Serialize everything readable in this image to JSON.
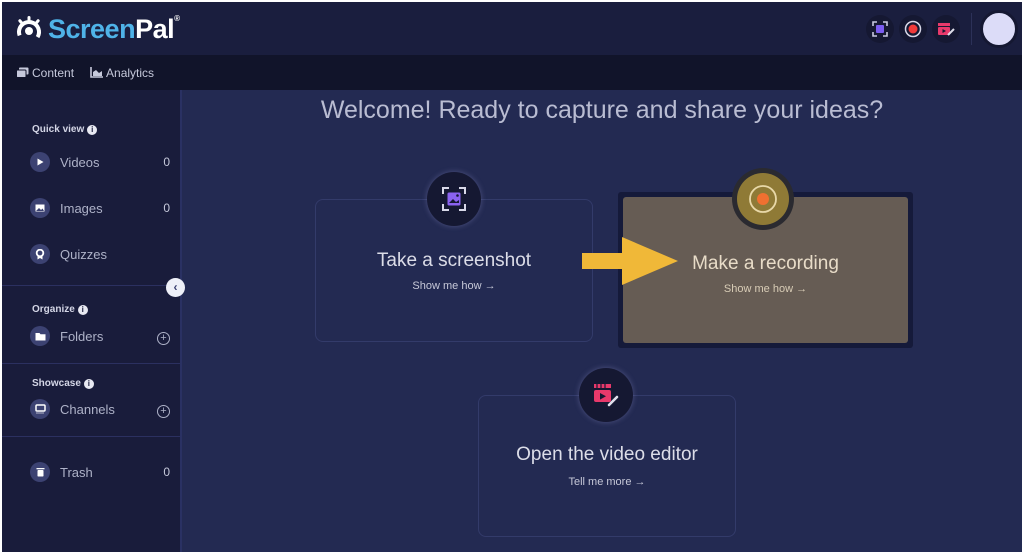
{
  "app": {
    "brand_prefix": "Screen",
    "brand_suffix": "Pal",
    "registered": "®"
  },
  "topbar": {
    "actions": [
      {
        "name": "screenshot",
        "icon": "screenshot-icon",
        "color": "#7b5cf0"
      },
      {
        "name": "record",
        "icon": "record-icon",
        "color": "#f03a3a"
      },
      {
        "name": "video-editor",
        "icon": "video-editor-icon",
        "color": "#e8396b"
      }
    ]
  },
  "subnav": {
    "items": [
      {
        "label": "Content",
        "icon": "content-icon"
      },
      {
        "label": "Analytics",
        "icon": "analytics-icon"
      }
    ]
  },
  "sidebar": {
    "quick_view": {
      "title": "Quick view",
      "info": "i",
      "items": [
        {
          "label": "Videos",
          "count": "0",
          "icon": "play-icon"
        },
        {
          "label": "Images",
          "count": "0",
          "icon": "image-icon"
        },
        {
          "label": "Quizzes",
          "count": "",
          "icon": "quiz-icon"
        }
      ]
    },
    "organize": {
      "title": "Organize",
      "info": "i",
      "items": [
        {
          "label": "Folders",
          "icon": "folder-icon",
          "action": "+"
        }
      ]
    },
    "showcase": {
      "title": "Showcase",
      "info": "i",
      "items": [
        {
          "label": "Channels",
          "icon": "channel-icon",
          "action": "+"
        }
      ]
    },
    "trash": {
      "label": "Trash",
      "count": "0",
      "icon": "trash-icon"
    },
    "collapse_label": "‹"
  },
  "main": {
    "welcome": "Welcome! Ready to capture and share your ideas?",
    "cards": [
      {
        "title": "Take a screenshot",
        "link": "Show me how →",
        "icon": "screenshot-icon"
      },
      {
        "title": "Make a recording",
        "link": "Show me how →",
        "icon": "record-icon",
        "highlighted": true
      },
      {
        "title": "Open the video editor",
        "link": "Tell me more →",
        "icon": "video-editor-icon"
      }
    ],
    "highlight_color": "#f0b838"
  }
}
